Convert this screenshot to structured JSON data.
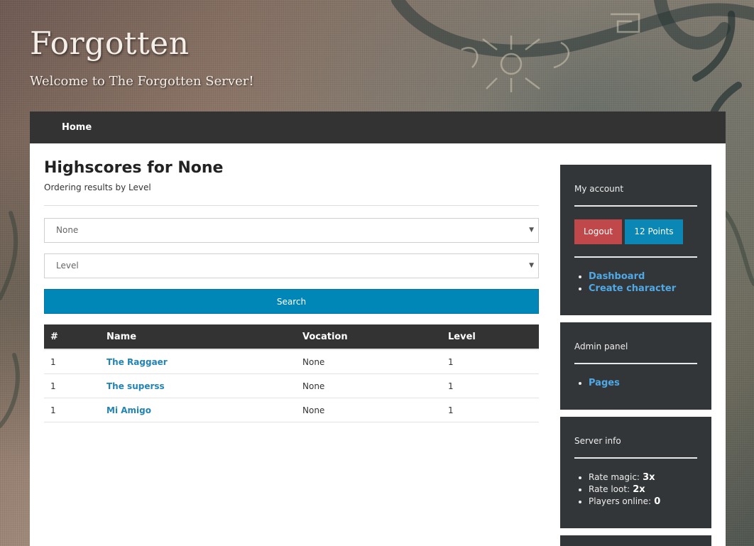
{
  "site": {
    "title": "Forgotten",
    "tagline": "Welcome to The Forgotten Server!"
  },
  "nav": {
    "items": [
      {
        "label": "Home"
      }
    ]
  },
  "main": {
    "title": "Highscores for None",
    "subtitle": "Ordering results by Level",
    "vocation_select": {
      "value": "None"
    },
    "order_select": {
      "value": "Level"
    },
    "search_label": "Search",
    "table": {
      "headers": [
        "#",
        "Name",
        "Vocation",
        "Level"
      ],
      "rows": [
        {
          "rank": "1",
          "name": "The Raggaer",
          "vocation": "None",
          "level": "1"
        },
        {
          "rank": "1",
          "name": "The superss",
          "vocation": "None",
          "level": "1"
        },
        {
          "rank": "1",
          "name": "Mi Amigo",
          "vocation": "None",
          "level": "1"
        }
      ]
    }
  },
  "sidebar": {
    "account": {
      "title": "My account",
      "logout_label": "Logout",
      "points_label": "12 Points",
      "links": [
        "Dashboard",
        "Create character"
      ]
    },
    "admin": {
      "title": "Admin panel",
      "links": [
        "Pages"
      ]
    },
    "server_info": {
      "title": "Server info",
      "items": [
        {
          "label": "Rate magic:",
          "value": "3x"
        },
        {
          "label": "Rate loot:",
          "value": "2x"
        },
        {
          "label": "Players online:",
          "value": "0"
        }
      ]
    }
  },
  "colors": {
    "navbar": "#333333",
    "search_button": "#0087b7",
    "logout_button": "#c0484a",
    "points_button": "#0a87b4",
    "link": "#2183b6",
    "sidebar_link": "#4fa9e6",
    "widget_bg": "#333638"
  },
  "icons": {
    "select_arrow": "caret-down-icon"
  }
}
